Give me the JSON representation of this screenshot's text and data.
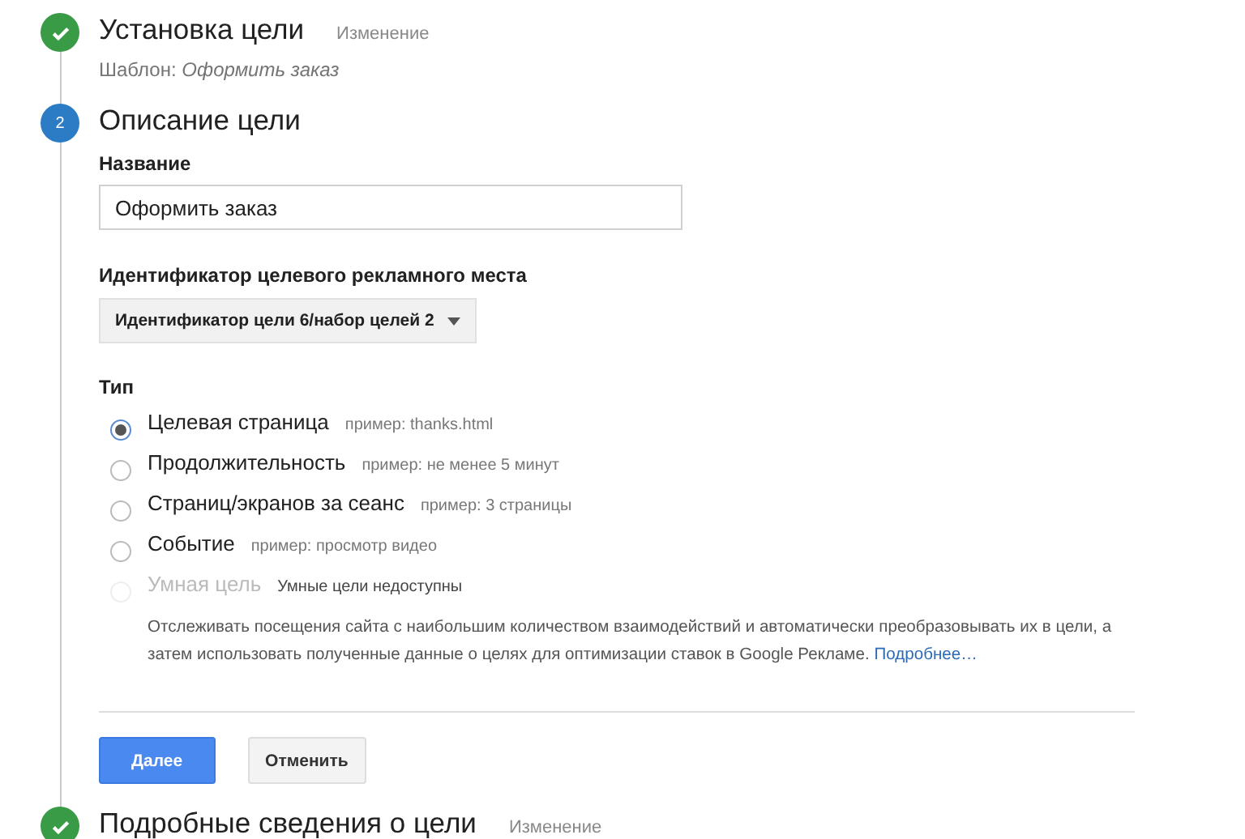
{
  "steps": [
    {
      "kind": "done",
      "title": "Установка цели",
      "edit_link": "Изменение",
      "summary_label": "Шаблон:",
      "summary_value": "Оформить заказ"
    },
    {
      "kind": "active",
      "number": "2",
      "title": "Описание цели"
    },
    {
      "kind": "done",
      "title": "Подробные сведения о цели",
      "edit_link": "Изменение"
    }
  ],
  "name_field": {
    "label": "Название",
    "value": "Оформить заказ"
  },
  "slot_select": {
    "label": "Идентификатор целевого рекламного места",
    "value": "Идентификатор цели 6/набор целей 2"
  },
  "type_group": {
    "label": "Тип",
    "options": [
      {
        "label": "Целевая страница",
        "hint": "пример: thanks.html",
        "selected": true,
        "disabled": false
      },
      {
        "label": "Продолжительность",
        "hint": "пример: не менее 5 минут",
        "selected": false,
        "disabled": false
      },
      {
        "label": "Страниц/экранов за сеанс",
        "hint": "пример: 3 страницы",
        "selected": false,
        "disabled": false
      },
      {
        "label": "Событие",
        "hint": "пример: просмотр видео",
        "selected": false,
        "disabled": false
      },
      {
        "label": "Умная цель",
        "hint": "Умные цели недоступны",
        "selected": false,
        "disabled": true
      }
    ],
    "description": "Отслеживать посещения сайта с наибольшим количеством взаимодействий и автоматически преобразовывать их в цели, а затем использовать полученные данные о целях для оптимизации ставок в Google Рекламе.",
    "more_link": "Подробнее…"
  },
  "buttons": [
    {
      "label": "Далее",
      "kind": "primary"
    },
    {
      "label": "Отменить",
      "kind": "secondary"
    }
  ]
}
